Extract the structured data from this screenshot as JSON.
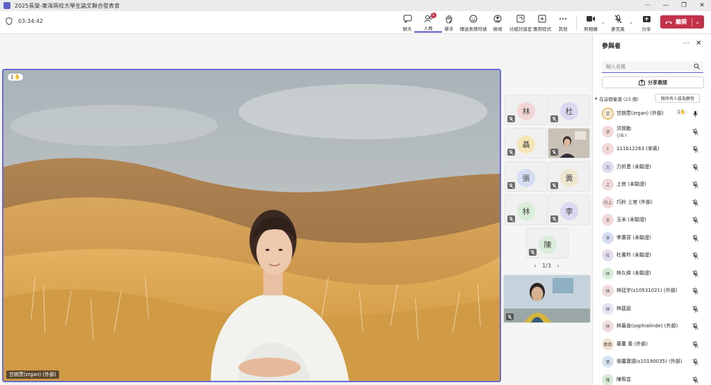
{
  "titlebar": {
    "title": "2025長榮-東海兩校大學生論文聯合發表會",
    "more": "···",
    "minimize": "—",
    "restore": "❐",
    "close": "✕"
  },
  "toolbar": {
    "elapsed": "03:34:42",
    "items": [
      {
        "label": "聊天",
        "icon": "chat-icon"
      },
      {
        "label": "人員",
        "icon": "people-icon",
        "badge": "1"
      },
      {
        "label": "舉手",
        "icon": "raise-hand-icon"
      },
      {
        "label": "傳送表情符號",
        "icon": "emoji-icon"
      },
      {
        "label": "檢視",
        "icon": "view-icon"
      },
      {
        "label": "分組討論室",
        "icon": "breakout-icon"
      },
      {
        "label": "應用程式",
        "icon": "apps-icon"
      },
      {
        "label": "其他",
        "icon": "more-icon"
      },
      {
        "label": "照相機",
        "icon": "camera-icon"
      },
      {
        "label": "麥克風",
        "icon": "mic-off-icon"
      },
      {
        "label": "分享",
        "icon": "share-icon"
      }
    ],
    "leave_label": "離開"
  },
  "stage": {
    "main_speaker": "甘婉萱(zrgan) (外部)",
    "raise_count": "1",
    "pager": "1/3",
    "tiles": [
      {
        "initial": "林",
        "color": "#f3d6d6"
      },
      {
        "initial": "杜",
        "color": "#ddd6f0"
      },
      {
        "initial": "聶",
        "color": "#f5e6b8"
      },
      {
        "initial": "張",
        "color": "#d6ddf3"
      },
      {
        "initial": "黃",
        "color": "#efe6cf"
      },
      {
        "initial": "林",
        "color": "#d8eed8"
      },
      {
        "initial": "李",
        "color": "#ddd8f3"
      },
      {
        "initial": "陳",
        "color": "#d9ecd9"
      }
    ]
  },
  "panel": {
    "title": "參與者",
    "more": "···",
    "close": "✕",
    "search_placeholder": "輸入名稱",
    "share_invite": "分享邀請",
    "section": "在這個會議 (23 個)",
    "mute_all": "將所有人設為靜音",
    "participants": [
      {
        "name": "甘婉萱(zrgan) (外部)",
        "initial": "甘",
        "color": "#f3e9d6",
        "raise": "1"
      },
      {
        "name": "洪賀勳",
        "role": "召集人",
        "initial": "洪",
        "color": "#f3d9d9"
      },
      {
        "name": "111b12263 (來賓)",
        "initial": "1",
        "color": "#f3d9d9"
      },
      {
        "name": "力祈恩 (未驗證)",
        "initial": "力",
        "color": "#dcdcf0"
      },
      {
        "name": "上官 (未驗證)",
        "initial": "上",
        "color": "#f3d9d9"
      },
      {
        "name": "巧鈴 上官 (外部)",
        "initial": "巧上",
        "color": "#f3d9d9"
      },
      {
        "name": "玉米 (未驗證)",
        "initial": "玉",
        "color": "#f3d9d9"
      },
      {
        "name": "李蕙容 (未驗證)",
        "initial": "李",
        "color": "#d6ddf3"
      },
      {
        "name": "杜書羚 (未驗證)",
        "initial": "杜",
        "color": "#e6dcf0"
      },
      {
        "name": "林久緯 (未驗證)",
        "initial": "林",
        "color": "#d9ecd9"
      },
      {
        "name": "林廷宇(s10531021) (外部)",
        "initial": "林",
        "color": "#f0dcdc"
      },
      {
        "name": "林莛庭",
        "initial": "林",
        "color": "#e6e1f3"
      },
      {
        "name": "林薰香(sophialinde) (外部)",
        "initial": "林",
        "color": "#f3dcdc"
      },
      {
        "name": "蕎薹 黃 (外部)",
        "initial": "蕎黃",
        "color": "#f3e2cf"
      },
      {
        "name": "張馨寶語(s10190035) (外部)",
        "initial": "張",
        "color": "#d6e2f3"
      },
      {
        "name": "陳宥芸",
        "initial": "陳",
        "color": "#d9ecd9"
      }
    ]
  }
}
